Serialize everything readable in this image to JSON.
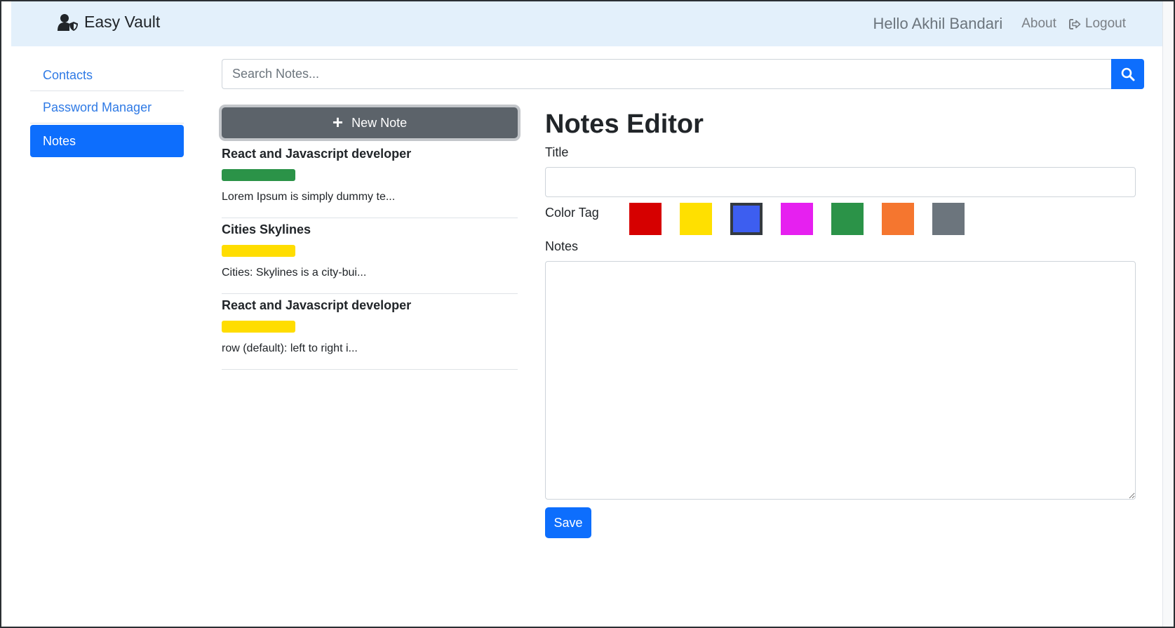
{
  "navbar": {
    "brand": "Easy Vault",
    "greeting": "Hello Akhil Bandari",
    "about": "About",
    "logout": "Logout"
  },
  "sidebar": {
    "items": [
      {
        "label": "Contacts"
      },
      {
        "label": "Password Manager"
      },
      {
        "label": "Notes",
        "active": true
      }
    ]
  },
  "search": {
    "placeholder": "Search Notes..."
  },
  "notes_list": {
    "new_note_label": "New Note",
    "items": [
      {
        "title": "React and Javascript developer",
        "tag_color": "#2b9348",
        "preview": "Lorem Ipsum is simply dummy te..."
      },
      {
        "title": "Cities Skylines",
        "tag_color": "#ffdd00",
        "preview": "Cities: Skylines is a city-bui..."
      },
      {
        "title": "React and Javascript developer",
        "tag_color": "#ffdd00",
        "preview": "row (default): left to right i..."
      }
    ]
  },
  "editor": {
    "heading": "Notes Editor",
    "title_label": "Title",
    "title_value": "",
    "color_tag_label": "Color Tag",
    "colors": [
      "#d60000",
      "#ffe000",
      "#3d5ef0",
      "#e620f0",
      "#2b9348",
      "#f5762f",
      "#6c757d"
    ],
    "selected_color": "#3d5ef0",
    "notes_label": "Notes",
    "notes_value": "",
    "save_label": "Save"
  },
  "theme": {
    "primary": "#0d6efd",
    "navbar_bg": "#e3f0fb",
    "new_note_bg": "#5c636a"
  }
}
